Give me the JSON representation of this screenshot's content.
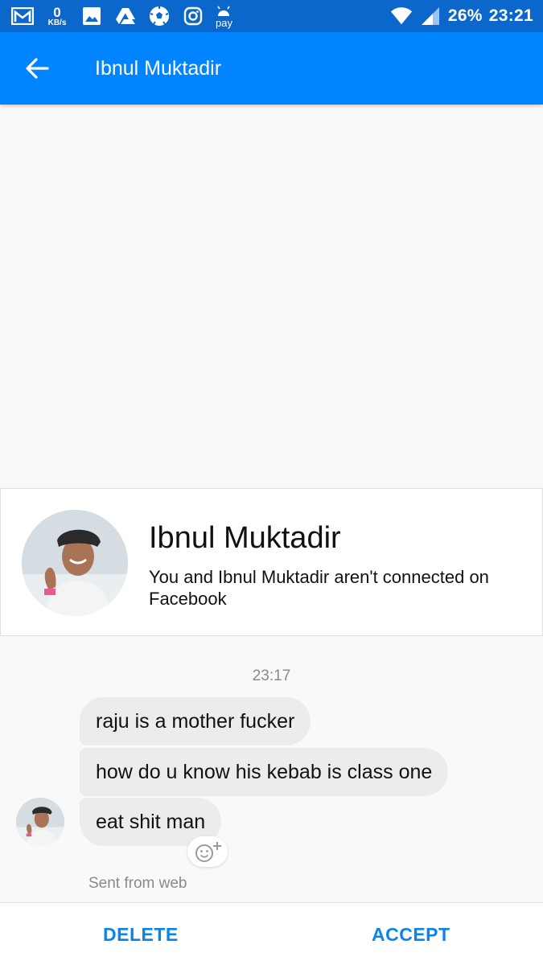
{
  "status_bar": {
    "net_speed_value": "0",
    "net_speed_unit": "KB/s",
    "pay_label": "pay",
    "battery": "26%",
    "time": "23:21",
    "icons": [
      "gmail-icon",
      "image-icon",
      "drive-icon",
      "soccer-ball-icon",
      "instagram-icon",
      "android-pay-icon",
      "wifi-icon",
      "cell-signal-icon"
    ]
  },
  "toolbar": {
    "title": "Ibnul Muktadir",
    "back_icon": "arrow-left-icon"
  },
  "profile": {
    "name": "Ibnul Muktadir",
    "subtitle": "You and Ibnul Muktadir aren't connected on Facebook"
  },
  "conversation": {
    "timestamp": "23:17",
    "messages": [
      {
        "text": "raju is a mother fucker"
      },
      {
        "text": "how do u know his kebab is class one"
      },
      {
        "text": "eat shit man"
      }
    ],
    "sent_from": "Sent from web"
  },
  "actions": {
    "delete_label": "DELETE",
    "accept_label": "ACCEPT"
  },
  "colors": {
    "status_bar": "#0c67cc",
    "toolbar": "#0084ff",
    "action_text": "#0b84e8",
    "bubble": "#ececec"
  }
}
